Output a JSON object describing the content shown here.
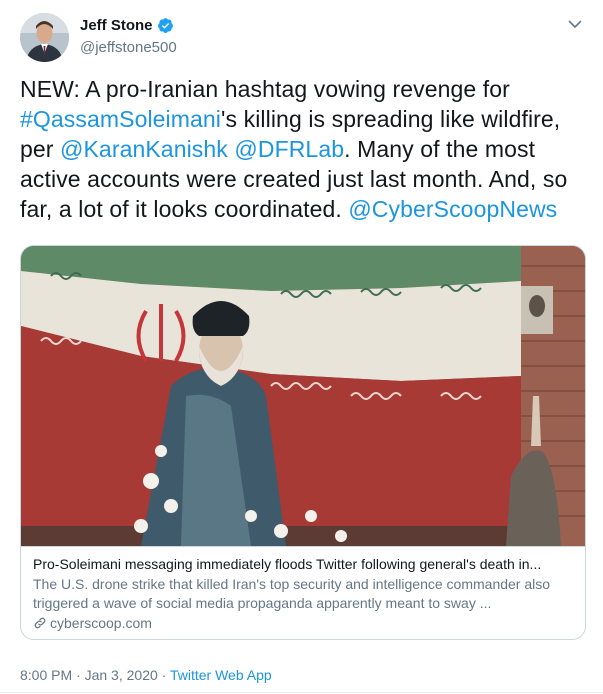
{
  "author": {
    "display_name": "Jeff Stone",
    "handle": "@jeffstone500"
  },
  "tweet": {
    "segments": [
      {
        "text": "NEW: A pro-Iranian hashtag vowing revenge for ",
        "link": false
      },
      {
        "text": "#QassamSoleimani",
        "link": true
      },
      {
        "text": "'s killing is spreading like wildfire, per ",
        "link": false
      },
      {
        "text": "@KaranKanishk",
        "link": true
      },
      {
        "text": " ",
        "link": false
      },
      {
        "text": "@DFRLab",
        "link": true
      },
      {
        "text": ". Many of the most active accounts were created just last month. And, so far, a lot of it looks coordinated. ",
        "link": false
      },
      {
        "text": "@CyberScoopNews",
        "link": true
      }
    ]
  },
  "card": {
    "title": "Pro-Soleimani messaging immediately floods Twitter following general's death in...",
    "description": "The U.S. drone strike that killed Iran's top security and intelligence commander also triggered a wave of social media propaganda apparently meant to sway ...",
    "domain": "cyberscoop.com"
  },
  "meta": {
    "time": "8:00 PM",
    "separator": " · ",
    "date": "Jan 3, 2020",
    "source": "Twitter Web App"
  },
  "colors": {
    "link": "#1b95e0",
    "text": "#14171a",
    "secondary": "#657786",
    "verified": "#1da1f2"
  },
  "icons": {
    "verified": "verified-badge-icon",
    "caret": "chevron-down-icon",
    "link": "link-icon"
  }
}
